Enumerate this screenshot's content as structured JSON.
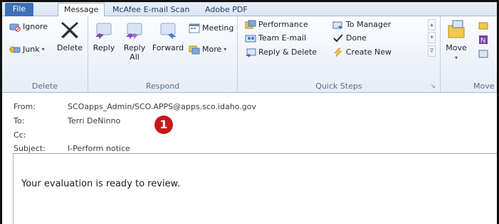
{
  "tabs": {
    "file": "File",
    "message": "Message",
    "mcafee": "McAfee E-mail Scan",
    "adobe": "Adobe PDF"
  },
  "ribbon": {
    "delete_group": {
      "label": "Delete",
      "ignore": "Ignore",
      "junk": "Junk",
      "delete": "Delete"
    },
    "respond_group": {
      "label": "Respond",
      "reply": "Reply",
      "reply_all_line1": "Reply",
      "reply_all_line2": "All",
      "forward": "Forward",
      "meeting": "Meeting",
      "more": "More"
    },
    "quick_steps": {
      "label": "Quick Steps",
      "performance": "Performance",
      "team_email": "Team E-mail",
      "reply_delete": "Reply & Delete",
      "to_manager": "To Manager",
      "done": "Done",
      "create_new": "Create New"
    },
    "move_group": {
      "label": "Move",
      "move": "Move"
    }
  },
  "message": {
    "from_label": "From:",
    "from_value": "SCOapps_Admin/SCO.APPS@apps.sco.idaho.gov",
    "to_label": "To:",
    "to_value": "Terri DeNinno",
    "cc_label": "Cc:",
    "cc_value": "",
    "subject_label": "Subject:",
    "subject_value": "I-Perform notice",
    "marker": "1",
    "body": "Your evaluation is ready to review."
  },
  "colors": {
    "file_tab": "#3e6fb8",
    "marker": "#c8171e"
  }
}
